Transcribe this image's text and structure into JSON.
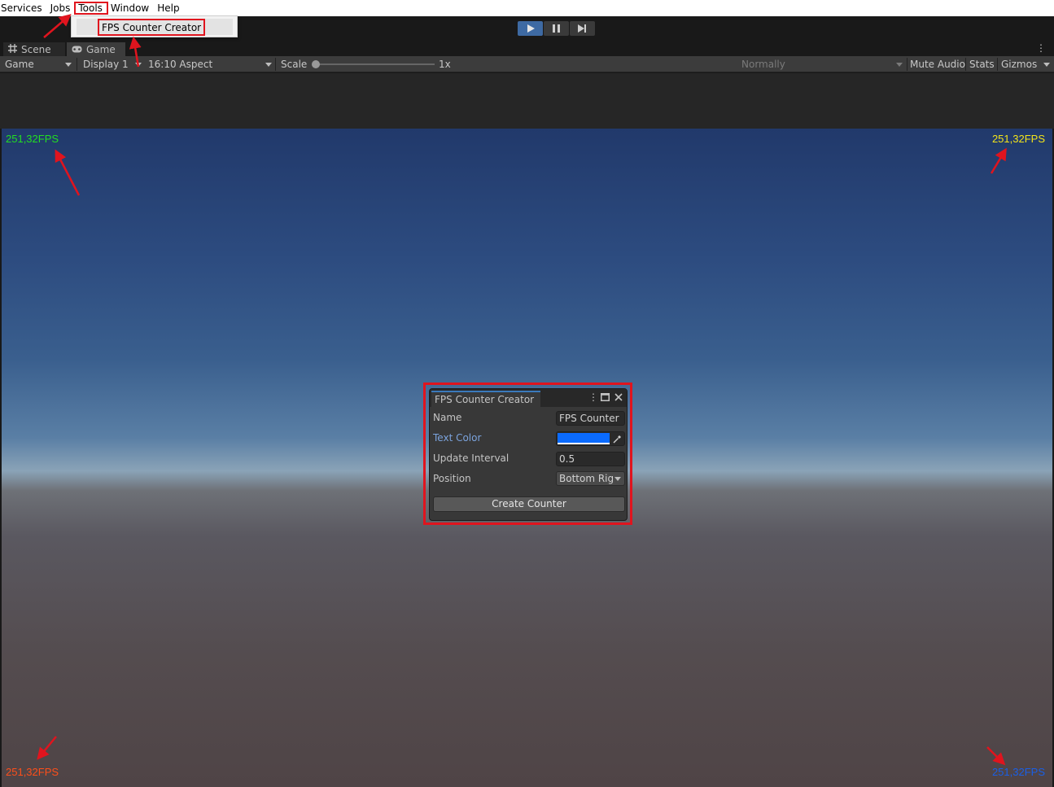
{
  "menubar": {
    "items": [
      "Services",
      "Jobs",
      "Tools",
      "Window",
      "Help"
    ],
    "highlighted": "Tools"
  },
  "dropdown": {
    "items": [
      "FPS Counter Creator"
    ]
  },
  "toolbar": {
    "play_state": "playing"
  },
  "tabs": [
    {
      "label": "Scene",
      "icon": "grid-icon"
    },
    {
      "label": "Game",
      "icon": "gamepad-icon",
      "active": true
    }
  ],
  "gamebar": {
    "view_select": "Game",
    "display": "Display 1",
    "aspect": "16:10 Aspect",
    "scale_label": "Scale",
    "scale_value": "1x",
    "play_focus": "Normally",
    "mute_audio": "Mute Audio",
    "stats": "Stats",
    "gizmos": "Gizmos"
  },
  "fps_counters": {
    "top_left": {
      "text": "251,32FPS",
      "color": "#22dd22"
    },
    "top_right": {
      "text": "251,32FPS",
      "color": "#f2e31a"
    },
    "bottom_left": {
      "text": "251,32FPS",
      "color": "#ff4f1a"
    },
    "bottom_right": {
      "text": "251,32FPS",
      "color": "#1a5fe6"
    }
  },
  "editor_window": {
    "title": "FPS Counter Creator",
    "fields": {
      "name_label": "Name",
      "name_value": "FPS Counter",
      "text_color_label": "Text Color",
      "text_color_value": "#0a6bff",
      "update_interval_label": "Update Interval",
      "update_interval_value": "0.5",
      "position_label": "Position",
      "position_value": "Bottom Right"
    },
    "create_button": "Create Counter"
  },
  "colors": {
    "highlight_red": "#e0141e",
    "accent_blue": "#3e6aa3"
  }
}
